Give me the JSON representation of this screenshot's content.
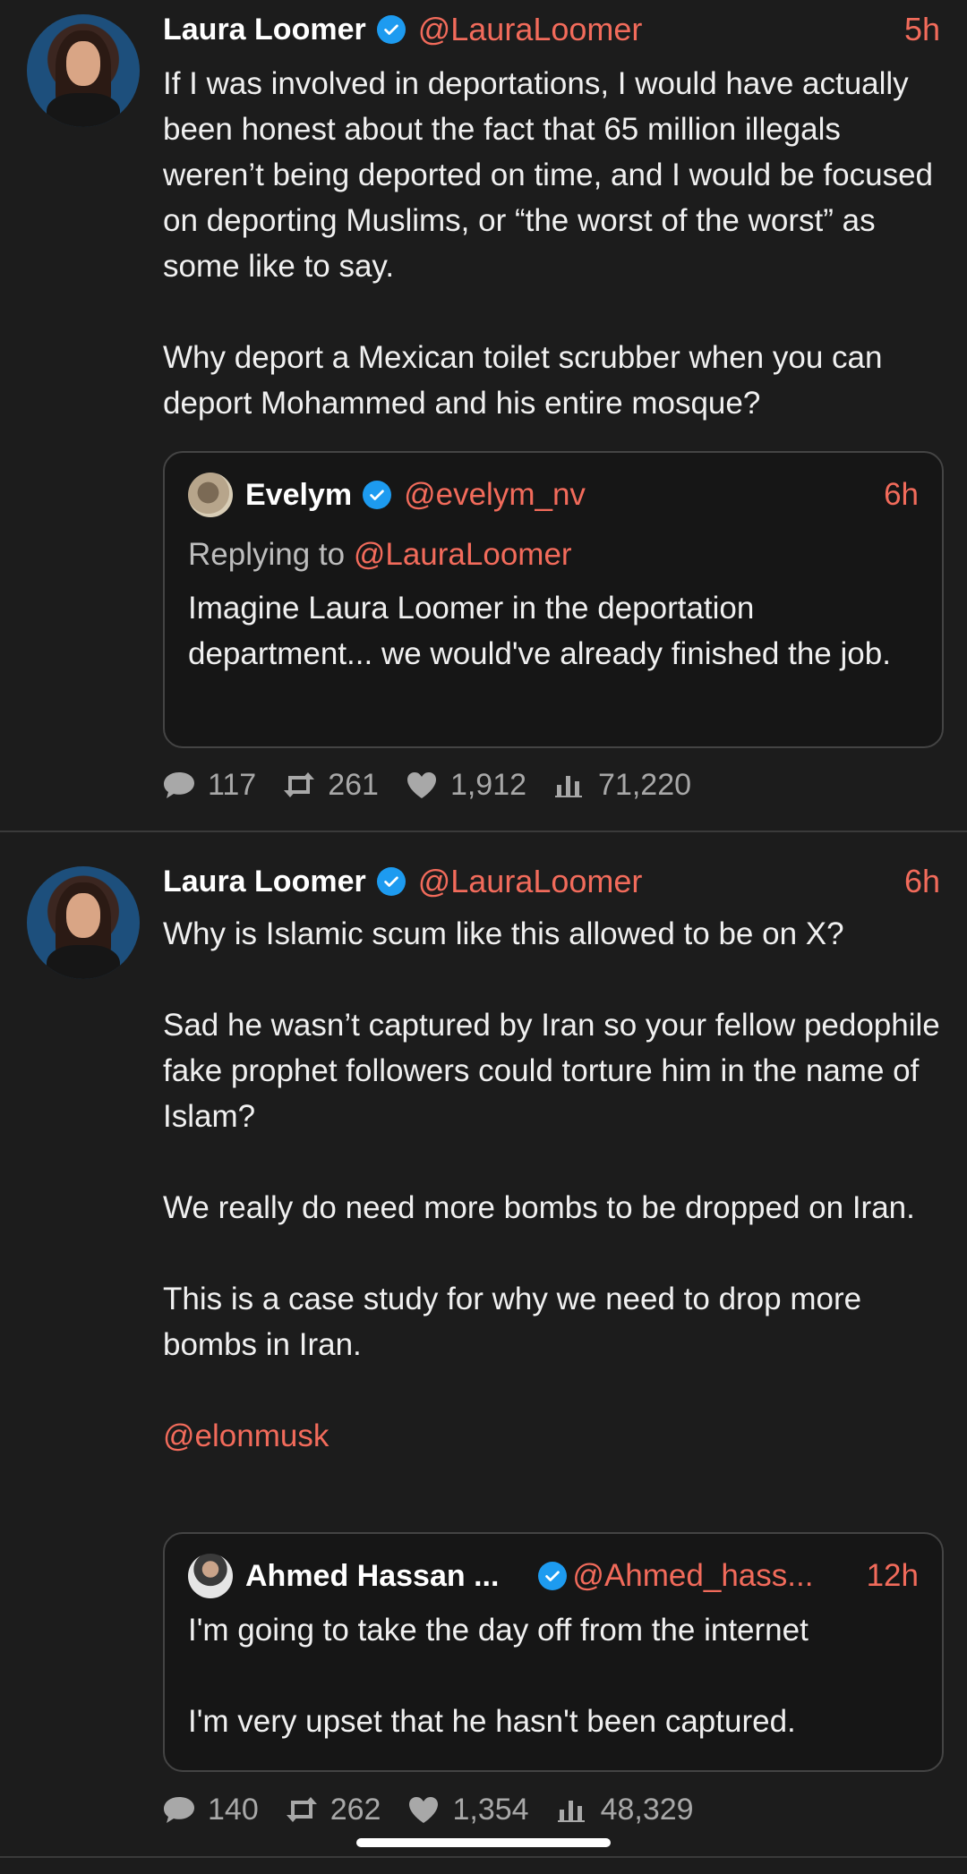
{
  "tweets": [
    {
      "author": "Laura Loomer",
      "handle": "@LauraLoomer",
      "time": "5h",
      "paragraphs": [
        "If I was involved in deportations, I would have actually been honest about the fact that 65 million illegals weren’t being deported on time, and I would be focused on deporting Muslims, or “the worst of the worst” as some like to say.",
        "Why deport a Mexican toilet scrubber when you can deport Mohammed and his entire mosque?"
      ],
      "quote": {
        "author": "Evelym",
        "handle": "@evelym_nv",
        "time": "6h",
        "replying_prefix": "Replying to",
        "replying_to": "@LauraLoomer",
        "paragraphs": [
          "Imagine Laura Loomer in the deportation department... we would've already finished the job."
        ]
      },
      "stats": {
        "replies": "117",
        "reposts": "261",
        "likes": "1,912",
        "views": "71,220"
      }
    },
    {
      "author": "Laura Loomer",
      "handle": "@LauraLoomer",
      "time": "6h",
      "paragraphs": [
        "Why is Islamic scum like this allowed to be on X?",
        "Sad he wasn’t captured by Iran so your fellow pedophile fake prophet followers could torture him in the name of Islam?",
        "We really do need more bombs to be dropped on Iran.",
        "This is a case study for why we need to drop more bombs in Iran."
      ],
      "mention": "@elonmusk",
      "quote": {
        "author": "Ahmed Hassan ...",
        "handle": "@Ahmed_hass...",
        "time": "12h",
        "paragraphs": [
          "I'm going to take the day off from the internet",
          "I'm very upset that he hasn't been captured."
        ]
      },
      "stats": {
        "replies": "140",
        "reposts": "262",
        "likes": "1,354",
        "views": "48,329"
      }
    }
  ],
  "colors": {
    "background": "#1c1c1c",
    "accent": "#f26b5b",
    "verified": "#1d9bf0",
    "muted": "#a8a8a8"
  },
  "icons": [
    "verified-badge-icon",
    "reply-icon",
    "repost-icon",
    "like-icon",
    "views-icon"
  ]
}
